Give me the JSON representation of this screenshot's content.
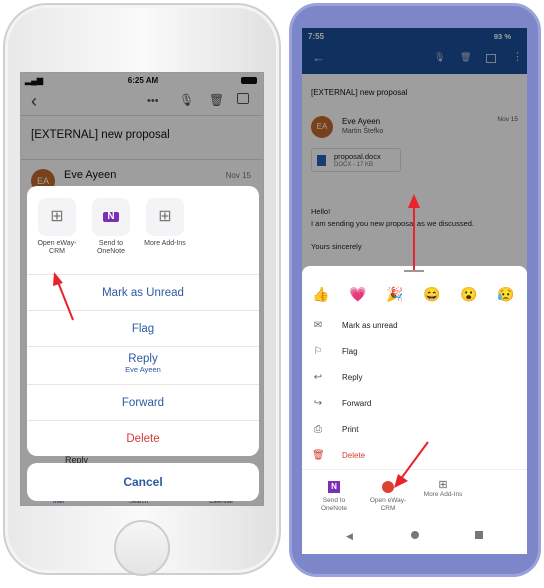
{
  "ios": {
    "time": "6:25 AM",
    "subject": "[EXTERNAL] new proposal",
    "sender_initials": "EA",
    "sender": "Eve Ayeen",
    "date": "Nov 15",
    "addins": [
      {
        "label": "Open eWay-CRM",
        "icon": "addin-grid-icon"
      },
      {
        "label": "Send to OneNote",
        "icon": "onenote-icon"
      },
      {
        "label": "More Add-Ins",
        "icon": "addin-grid-icon"
      }
    ],
    "actions": {
      "mark_unread": "Mark as Unread",
      "flag": "Flag",
      "reply": "Reply",
      "reply_sub": "Eve Ayeen",
      "forward": "Forward",
      "delete": "Delete"
    },
    "cancel": "Cancel",
    "behind_reply": "Reply",
    "tabs": [
      "Mail",
      "Search",
      "Calendar"
    ]
  },
  "android": {
    "time": "7:55",
    "battery": "93 %",
    "subject": "[EXTERNAL] new proposal",
    "sender_initials": "EA",
    "sender": "Eve Ayeen",
    "recipient": "Martin Štefko",
    "date": "Nov 15",
    "attachment": {
      "name": "proposal.docx",
      "meta": "DOCX - 17 KB"
    },
    "body": [
      "Hello!",
      "I am sending you new proposal as we discussed.",
      "Yours sincerely"
    ],
    "reactions": [
      "👍",
      "💗",
      "🎉",
      "😄",
      "😮",
      "😥"
    ],
    "menu": [
      {
        "label": "Mark as unread",
        "icon": "mail-icon"
      },
      {
        "label": "Flag",
        "icon": "flag-icon"
      },
      {
        "label": "Reply",
        "icon": "reply-icon"
      },
      {
        "label": "Forward",
        "icon": "forward-icon"
      },
      {
        "label": "Print",
        "icon": "print-icon"
      },
      {
        "label": "Delete",
        "icon": "trash-icon"
      }
    ],
    "addins": [
      {
        "label": "Send to OneNote"
      },
      {
        "label": "Open eWay-CRM"
      },
      {
        "label": "More Add-Ins"
      }
    ]
  },
  "colors": {
    "ios_accent": "#2b5aa3",
    "delete": "#d43b33",
    "android_bar": "#1a4e9c",
    "annotation_arrow": "#e8232b"
  }
}
